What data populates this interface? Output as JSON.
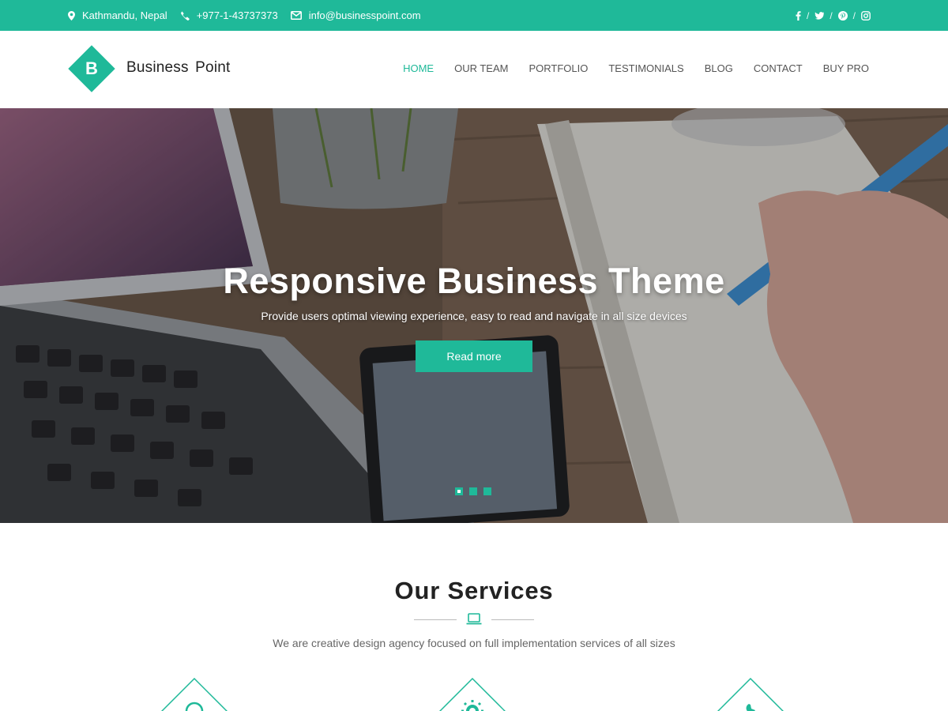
{
  "topbar": {
    "location": "Kathmandu, Nepal",
    "phone": "+977-1-43737373",
    "email": "info@businesspoint.com",
    "social": [
      "facebook-icon",
      "twitter-icon",
      "pinterest-icon",
      "instagram-icon"
    ],
    "separator": "/"
  },
  "header": {
    "logo_letter": "B",
    "site_name": "Business Point",
    "nav": [
      {
        "label": "HOME",
        "active": true
      },
      {
        "label": "OUR TEAM",
        "active": false
      },
      {
        "label": "PORTFOLIO",
        "active": false
      },
      {
        "label": "TESTIMONIALS",
        "active": false
      },
      {
        "label": "BLOG",
        "active": false
      },
      {
        "label": "CONTACT",
        "active": false
      },
      {
        "label": "BUY PRO",
        "active": false
      }
    ]
  },
  "hero": {
    "title": "Responsive Business Theme",
    "subtitle": "Provide users optimal viewing experience, easy to read and navigate in all size devices",
    "button_label": "Read more",
    "slide_count": 3,
    "active_slide": 1
  },
  "services": {
    "title": "Our Services",
    "subtitle": "We are creative design agency focused on full implementation services of all sizes",
    "divider_icon": "laptop-icon",
    "items": [
      {
        "icon": "globe-icon"
      },
      {
        "icon": "gear-icon"
      },
      {
        "icon": "wrench-icon"
      }
    ]
  },
  "colors": {
    "accent": "#1fb999",
    "text_dark": "#222222",
    "text_muted": "#666666"
  }
}
